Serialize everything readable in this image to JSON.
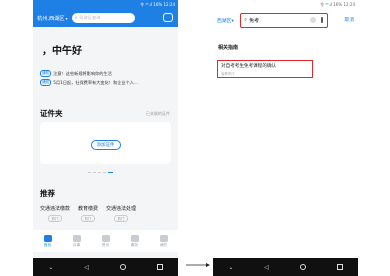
{
  "status_bar": {
    "text": "令 ⁴⁶.ıl 16% 12:24"
  },
  "left_screen": {
    "city": "杭州,西湖区",
    "search_placeholder": "驾驶证查询",
    "greeting": "，中午好",
    "notices": [
      {
        "tag": "通知",
        "text": "注意！这些新规将影响你的生活"
      },
      {
        "tag": "通知",
        "text": "5月1日起，社保费率有大变化！和企业个人..."
      }
    ],
    "card_section": {
      "title": "证件夹",
      "more": "已关联的证件",
      "add_button": "添加证件"
    },
    "recommend": {
      "title": "推荐",
      "items": [
        {
          "name": "交通违法缴款",
          "pill": "热门"
        },
        {
          "name": "教育缴费",
          "pill": "热门"
        },
        {
          "name": "交通违法处理",
          "pill": "热门"
        },
        {
          "name": "",
          "pill": ""
        }
      ]
    },
    "tabs": [
      {
        "label": "首页",
        "active": true
      },
      {
        "label": "办事",
        "active": false
      },
      {
        "label": "资讯",
        "active": false
      },
      {
        "label": "服务",
        "active": false
      },
      {
        "label": "我的",
        "active": false
      }
    ]
  },
  "right_screen": {
    "city": "西湖区",
    "search_value": "免考",
    "cancel": "取消",
    "related_title": "相关指南",
    "result": {
      "title": "对自考考生免考课程的确认",
      "subtitle": "省教育厅"
    }
  },
  "nav": {
    "back": "◁"
  }
}
